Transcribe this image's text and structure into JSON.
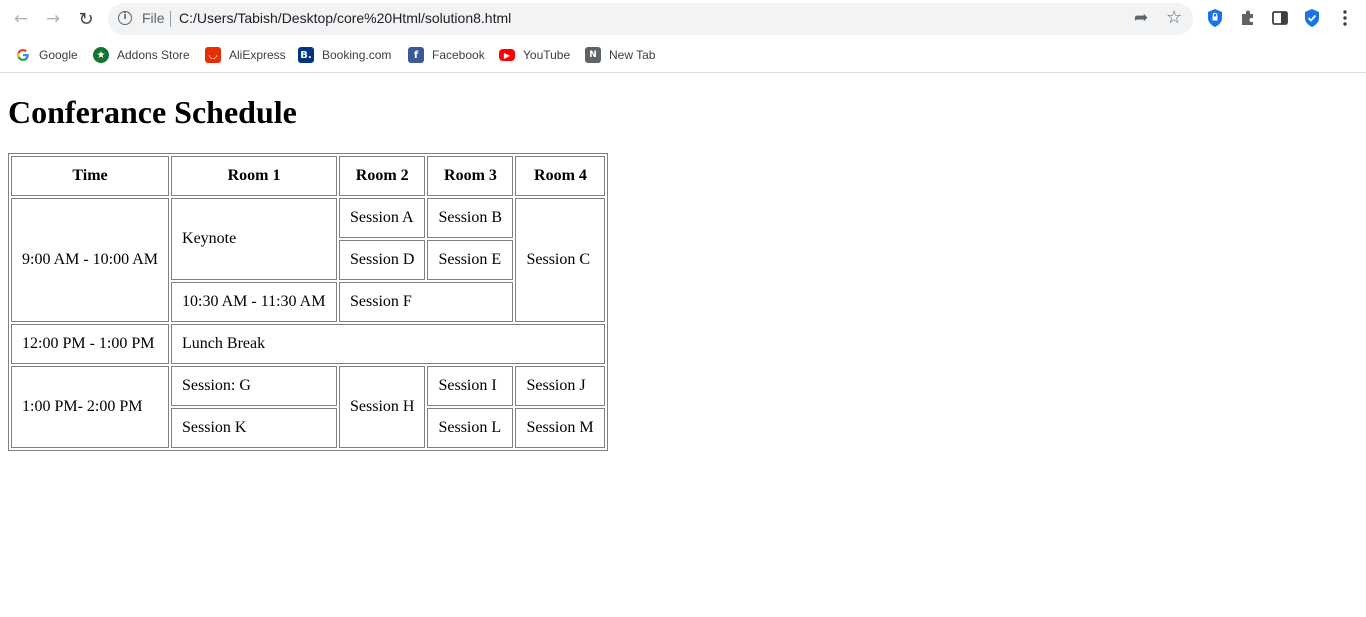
{
  "browser": {
    "back_icon": "arrow-left-icon",
    "forward_icon": "arrow-right-icon",
    "reload_icon": "reload-icon",
    "file_label": "File",
    "url": "C:/Users/Tabish/Desktop/core%20Html/solution8.html",
    "bookmarks": [
      {
        "label": "Google",
        "icon": "google-icon",
        "color": "#4285f4"
      },
      {
        "label": "Addons Store",
        "icon": "addons-store-icon",
        "color": "#137333"
      },
      {
        "label": "AliExpress",
        "icon": "aliexpress-icon",
        "color": "#e62e04"
      },
      {
        "label": "Booking.com",
        "icon": "booking-icon",
        "color": "#003580"
      },
      {
        "label": "Facebook",
        "icon": "facebook-icon",
        "color": "#3b5998"
      },
      {
        "label": "YouTube",
        "icon": "youtube-icon",
        "color": "#ff0000"
      },
      {
        "label": "New Tab",
        "icon": "new-tab-icon",
        "color": "#5f6368"
      }
    ]
  },
  "page": {
    "title": "Conferance Schedule",
    "table": {
      "headers": [
        "Time",
        "Room 1",
        "Room 2",
        "Room 3",
        "Room 4"
      ],
      "time_1": "9:00 AM - 10:00 AM",
      "keynote": "Keynote",
      "session_a": "Session A",
      "session_b": "Session B",
      "session_c": "Session C",
      "session_d": "Session D",
      "session_e": "Session E",
      "time_2": "10:30 AM - 11:30 AM",
      "session_f": "Session F",
      "time_3": "12:00 PM - 1:00 PM",
      "lunch": "Lunch Break",
      "time_4": "1:00 PM- 2:00 PM",
      "session_g": "Session: G",
      "session_h": "Session H",
      "session_i": "Session I",
      "session_j": "Session J",
      "session_k": "Session K",
      "session_l": "Session L",
      "session_m": "Session M"
    }
  }
}
